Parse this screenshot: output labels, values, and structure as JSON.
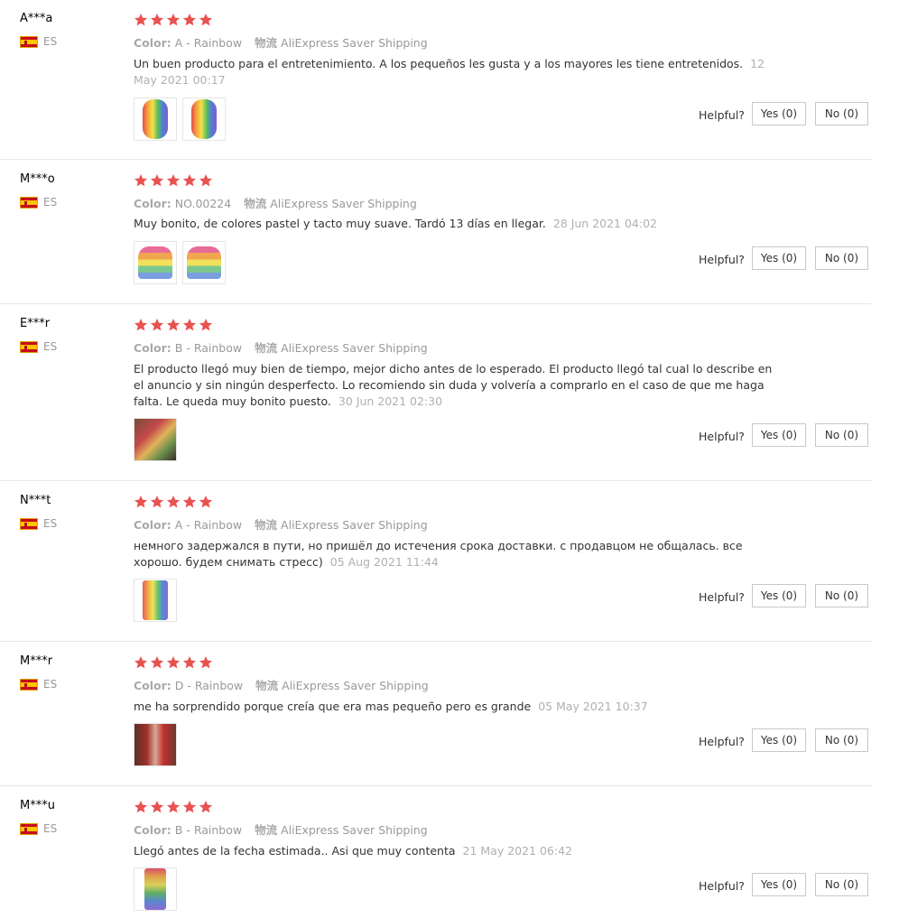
{
  "colors": {
    "star": "#e8524f",
    "meta_text": "#999999",
    "date_text": "#b0b0b0",
    "divider": "#e8e8e8"
  },
  "reviews": [
    {
      "user": "A***a",
      "country": "ES",
      "rating": 5,
      "color_label": "Color:",
      "color_value": "A - Rainbow",
      "shipping_label": "物流",
      "shipping_value": "AliExpress Saver Shipping",
      "text": "Un buen producto para el entretenimiento. A los pequeños les gusta y a los mayores les tiene entretenidos.",
      "date": "12 May 2021 00:17",
      "photos": [
        "rainbow-circle",
        "rainbow-circle"
      ],
      "helpful_label": "Helpful?",
      "yes_label": "Yes (0)",
      "no_label": "No (0)"
    },
    {
      "user": "M***o",
      "country": "ES",
      "rating": 5,
      "color_label": "Color:",
      "color_value": "NO.00224",
      "shipping_label": "物流",
      "shipping_value": "AliExpress Saver Shipping",
      "text": "Muy bonito, de colores pastel y tacto muy suave. Tardó 13 días en llegar.",
      "date": "28 Jun 2021 04:02",
      "photos": [
        "cake",
        "cake"
      ],
      "helpful_label": "Helpful?",
      "yes_label": "Yes (0)",
      "no_label": "No (0)"
    },
    {
      "user": "E***r",
      "country": "ES",
      "rating": 5,
      "color_label": "Color:",
      "color_value": "B - Rainbow",
      "shipping_label": "物流",
      "shipping_value": "AliExpress Saver Shipping",
      "text": "El producto llegó muy bien de tiempo, mejor dicho antes de lo esperado. El producto llegó tal cual lo describe en el anuncio y sin ningún desperfecto. Lo recomiendo sin duda y volvería a comprarlo en el caso de que me haga falta. Le queda muy bonito puesto.",
      "date": "30 Jun 2021 02:30",
      "photos": [
        "photo-a"
      ],
      "helpful_label": "Helpful?",
      "yes_label": "Yes (0)",
      "no_label": "No (0)"
    },
    {
      "user": "N***t",
      "country": "ES",
      "rating": 5,
      "color_label": "Color:",
      "color_value": "A - Rainbow",
      "shipping_label": "物流",
      "shipping_value": "AliExpress Saver Shipping",
      "text": "немного задержался в пути, но пришёл до истечения срока доставки. с продавцом не общалась. все хорошо. будем снимать стресс)",
      "date": "05 Aug 2021 11:44",
      "photos": [
        "rainbow-tall"
      ],
      "helpful_label": "Helpful?",
      "yes_label": "Yes (0)",
      "no_label": "No (0)"
    },
    {
      "user": "M***r",
      "country": "ES",
      "rating": 5,
      "color_label": "Color:",
      "color_value": "D - Rainbow",
      "shipping_label": "物流",
      "shipping_value": "AliExpress Saver Shipping",
      "text": "me ha sorprendido porque creía que era mas pequeño pero es grande",
      "date": "05 May 2021 10:37",
      "photos": [
        "photo-b"
      ],
      "helpful_label": "Helpful?",
      "yes_label": "Yes (0)",
      "no_label": "No (0)"
    },
    {
      "user": "M***u",
      "country": "ES",
      "rating": 5,
      "color_label": "Color:",
      "color_value": "B - Rainbow",
      "shipping_label": "物流",
      "shipping_value": "AliExpress Saver Shipping",
      "text": "Llegó antes de la fecha estimada.. Asi que muy contenta",
      "date": "21 May 2021 06:42",
      "photos": [
        "phone"
      ],
      "helpful_label": "Helpful?",
      "yes_label": "Yes (0)",
      "no_label": "No (0)"
    }
  ]
}
